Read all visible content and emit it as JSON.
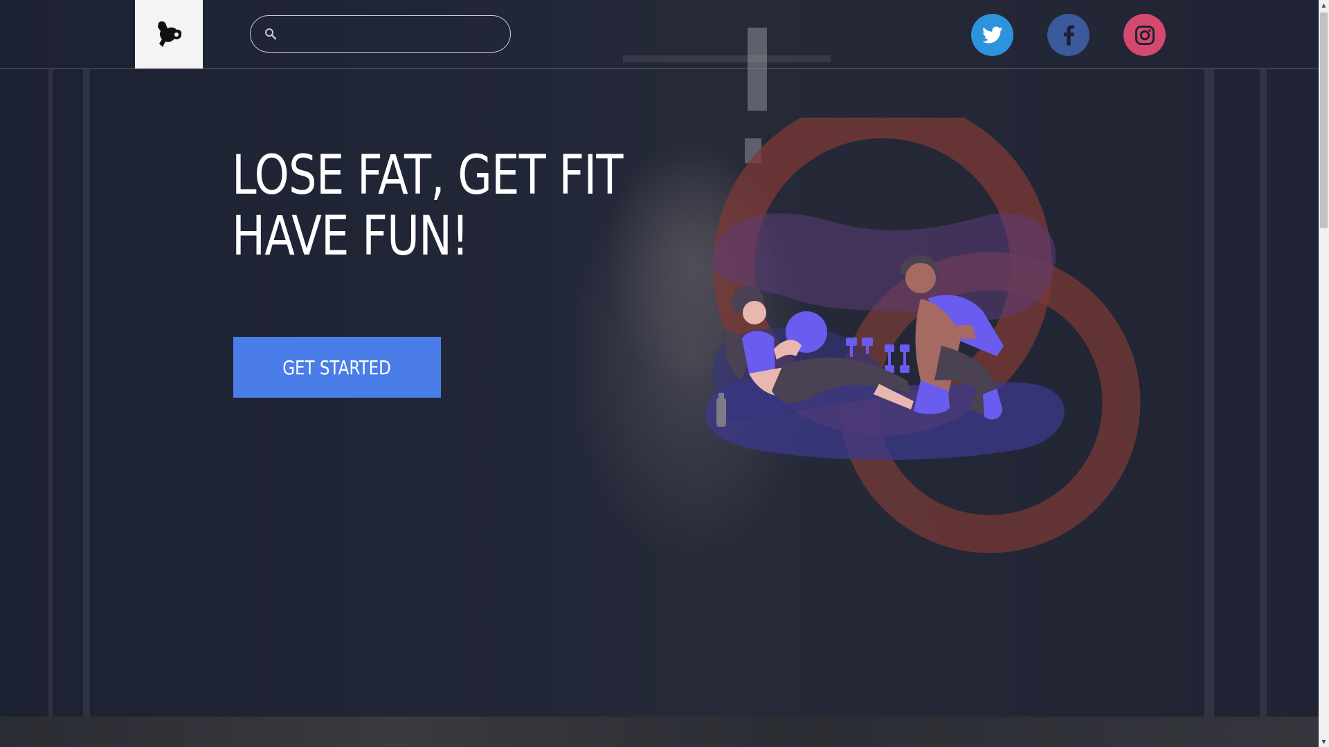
{
  "header": {
    "logo_icon": "flexing-arm-icon",
    "search": {
      "value": "",
      "placeholder": "",
      "icon": "search-icon"
    },
    "social": [
      {
        "name": "twitter",
        "icon": "twitter-icon",
        "color": "#2d93dd"
      },
      {
        "name": "facebook",
        "icon": "facebook-icon",
        "color": "#3a5a9c"
      },
      {
        "name": "instagram",
        "icon": "instagram-icon",
        "color": "#d5496f"
      }
    ]
  },
  "hero": {
    "headline_line1": "LOSE FAT, GET FIT",
    "headline_line2": "HAVE FUN!",
    "cta_label": "GET STARTED",
    "cta_color": "#4b7de8",
    "illustration": "two-people-exercising-illustration"
  },
  "colors": {
    "background": "#1c2030",
    "accent_ring": "#8a3f3a",
    "figure_purple": "#6b5cf0"
  }
}
